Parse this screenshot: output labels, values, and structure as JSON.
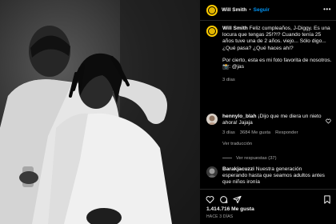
{
  "post": {
    "author": "Will Smith",
    "separator": "•",
    "follow_label": "Seguir",
    "more_icon": "more-horizontal-icon",
    "avatar_color": "#ffcc00"
  },
  "caption": {
    "author": "Will Smith",
    "text": "Feliz cumpleaños, J-Diggy. Es una locura que tengas 25!?!? Cuando tenía 25 años tuve una de 2 años. viejo... Sólo digo... ¿Qué pasa? ¿Qué haces ahí?",
    "extra": "Por cierto, esta es mi foto favorita de nosotros. 📸: @jas",
    "time": "3 días"
  },
  "comments": [
    {
      "author": "hennylo_blah",
      "text": "¡Dijo que me diera un nieto ahora! Jajaja",
      "time": "3 días",
      "likes": "3684 Me gusta",
      "reply_label": "Responder",
      "translation_label": "Ver traducción",
      "replies_label": "Ver respuestas (37)"
    },
    {
      "author": "Barakjacuzzi",
      "text": "Nuestra generación esperando hasta que seamos adultos antes que niños ironía"
    }
  ],
  "footer": {
    "likes": "1.414.716 Me gusta",
    "date": "HACE 3 DÍAS"
  },
  "colors": {
    "accent": "#0095f6",
    "muted": "#a8a8a8",
    "background": "#000000"
  }
}
